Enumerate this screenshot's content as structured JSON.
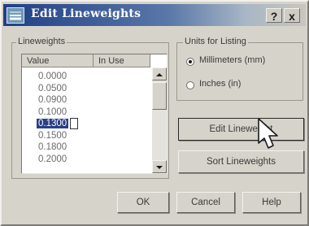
{
  "window": {
    "title": "Edit Lineweights",
    "help_btn": "?",
    "close_btn": "x"
  },
  "lineweights": {
    "group_label": "Lineweights",
    "col_value": "Value",
    "col_inuse": "In Use",
    "rows": [
      "0.0000",
      "0.0500",
      "0.0900",
      "0.1000",
      "0.1300",
      "0.1500",
      "0.1800",
      "0.2000"
    ],
    "selected_index": 4
  },
  "units": {
    "group_label": "Units for Listing",
    "millimeters": "Millimeters (mm)",
    "inches": "Inches (in)",
    "selected": "millimeters"
  },
  "buttons": {
    "edit": "Edit Lineweight",
    "sort": "Sort Lineweights",
    "ok": "OK",
    "cancel": "Cancel",
    "help": "Help"
  },
  "icons": {
    "title": "lineweight-app-icon",
    "cursor": "mouse-pointer-icon"
  }
}
